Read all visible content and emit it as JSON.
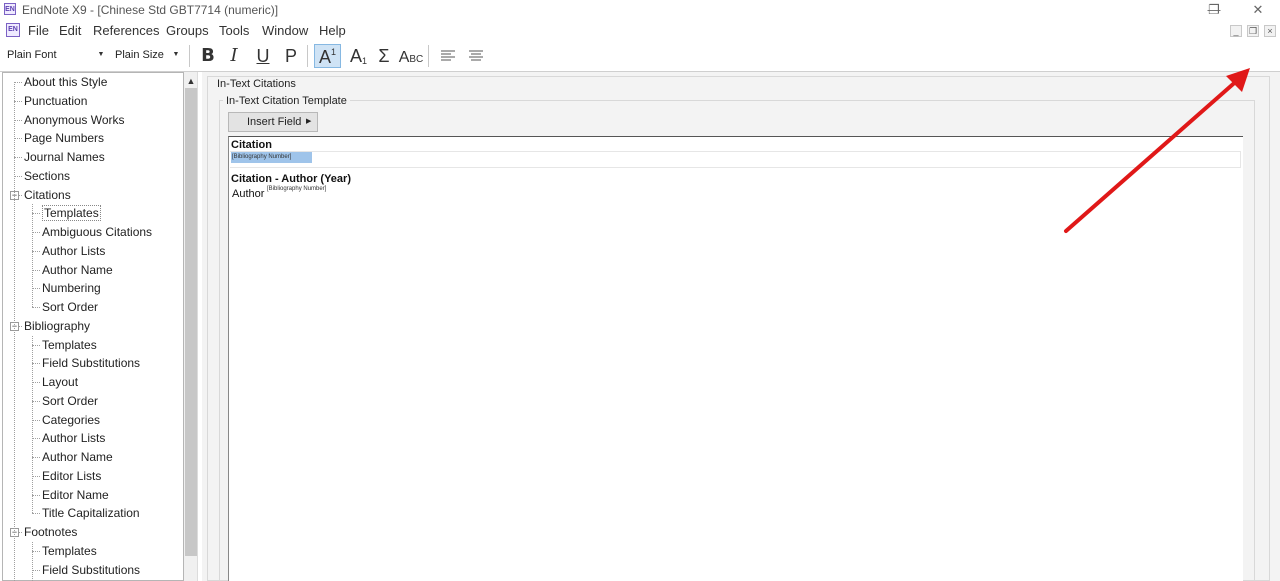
{
  "window": {
    "title": "EndNote X9 - [Chinese Std GBT7714 (numeric)]",
    "icon_text": "EN"
  },
  "menu": [
    "File",
    "Edit",
    "References",
    "Groups",
    "Tools",
    "Window",
    "Help"
  ],
  "toolbar": {
    "font_label": "Plain Font",
    "size_label": "Plain Size",
    "bold": "B",
    "italic": "I",
    "underline": "U",
    "plain": "P",
    "superscript_base": "A",
    "superscript_mark": "1",
    "subscript_base": "A",
    "subscript_mark": "1",
    "sigma": "Σ",
    "smallcaps_a": "A",
    "smallcaps_rest": "BC"
  },
  "tree": {
    "items": [
      {
        "label": "About this Style"
      },
      {
        "label": "Punctuation"
      },
      {
        "label": "Anonymous Works"
      },
      {
        "label": "Page Numbers"
      },
      {
        "label": "Journal Names"
      },
      {
        "label": "Sections"
      },
      {
        "label": "Citations"
      },
      {
        "label": "Templates"
      },
      {
        "label": "Ambiguous Citations"
      },
      {
        "label": "Author Lists"
      },
      {
        "label": "Author Name"
      },
      {
        "label": "Numbering"
      },
      {
        "label": "Sort Order"
      },
      {
        "label": "Bibliography"
      },
      {
        "label": "Templates"
      },
      {
        "label": "Field Substitutions"
      },
      {
        "label": "Layout"
      },
      {
        "label": "Sort Order"
      },
      {
        "label": "Categories"
      },
      {
        "label": "Author Lists"
      },
      {
        "label": "Author Name"
      },
      {
        "label": "Editor Lists"
      },
      {
        "label": "Editor Name"
      },
      {
        "label": "Title Capitalization"
      },
      {
        "label": "Footnotes"
      },
      {
        "label": "Templates"
      },
      {
        "label": "Field Substitutions"
      }
    ],
    "collapse_glyph": "−"
  },
  "panel": {
    "outer_title": "In-Text Citations",
    "inner_title": "In-Text Citation Template",
    "insert_field_label": "Insert Field",
    "citation_heading": "Citation",
    "citation_template": "[Bibliography Number]",
    "author_year_heading": "Citation - Author (Year)",
    "author_year_prefix": "Author",
    "author_year_template": "[Bibliography Number]"
  },
  "colors": {
    "selected_tool": "#cfe3f5",
    "field_highlight": "#9fc4ea",
    "annotation_arrow": "#e01818"
  }
}
